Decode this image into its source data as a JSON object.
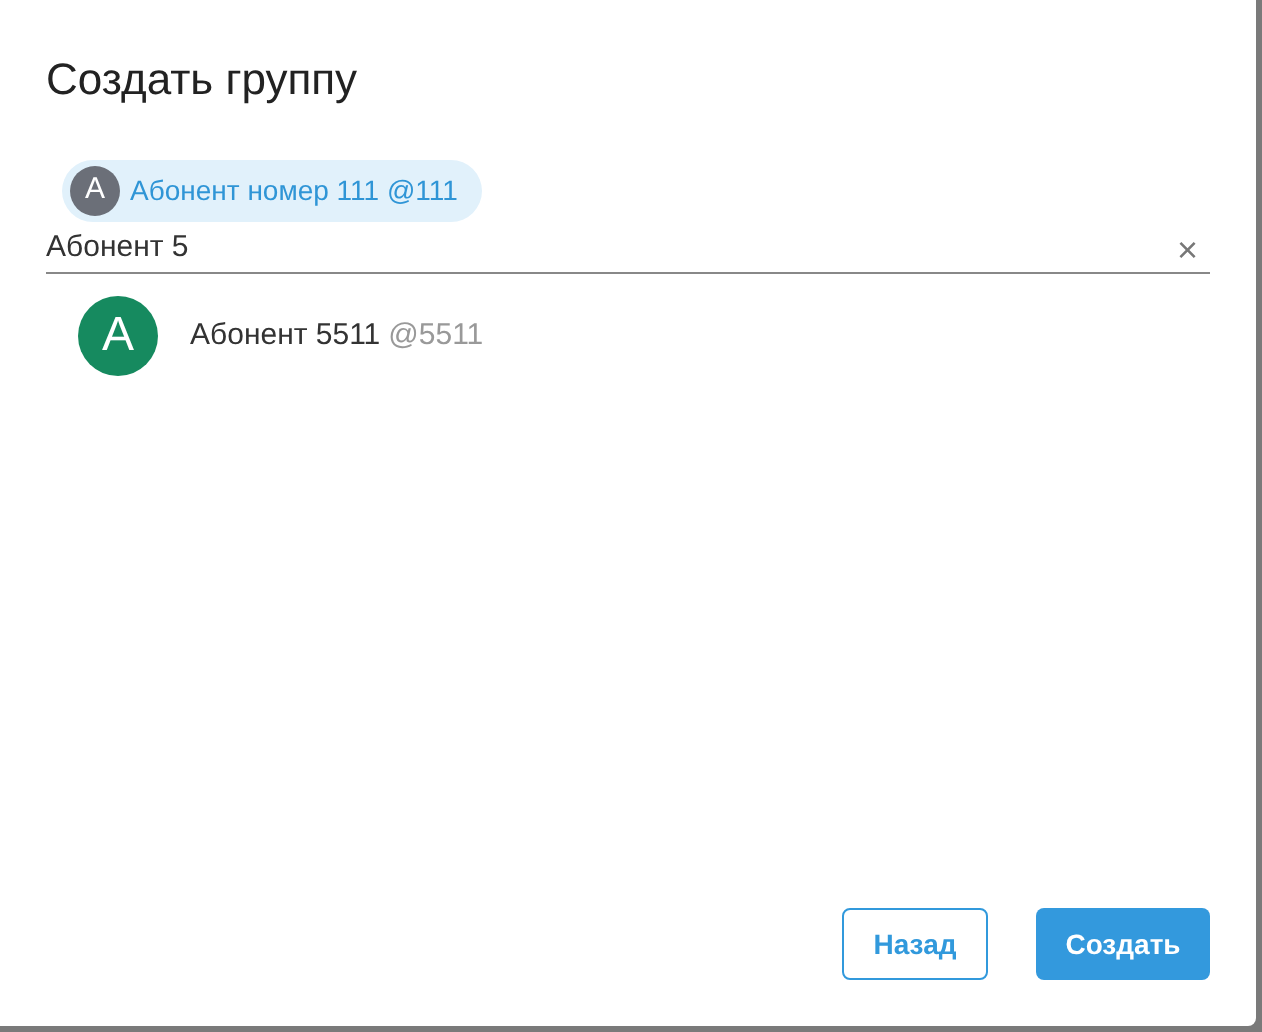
{
  "dialog": {
    "title": "Создать группу"
  },
  "selected_chips": [
    {
      "initial": "A",
      "label": "Абонент номер 111 @111",
      "color": "#6b6f78"
    }
  ],
  "search": {
    "value": "Абонент 5",
    "clear": "×"
  },
  "results": [
    {
      "initial": "A",
      "name": "Абонент 5511",
      "handle": "@5511",
      "color": "#168a5f"
    }
  ],
  "buttons": [
    {
      "label": "Назад",
      "kind": "outline"
    },
    {
      "label": "Создать",
      "kind": "primary"
    }
  ]
}
